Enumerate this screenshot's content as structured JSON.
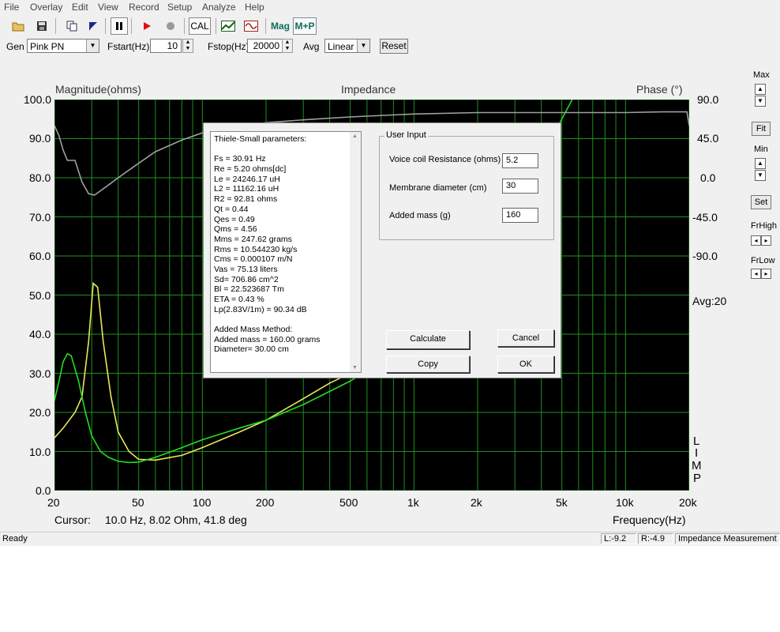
{
  "menu": [
    "File",
    "Overlay",
    "Edit",
    "View",
    "Record",
    "Setup",
    "Analyze",
    "Help"
  ],
  "toolbar": {
    "icons": [
      "open-folder-icon",
      "save-disk-icon",
      "copy-icon",
      "flag-icon",
      "pause-icon",
      "record-icon",
      "stop-icon",
      "cal-button",
      "response-icon",
      "waveform-icon",
      "mag-button",
      "mp-button"
    ],
    "cal_label": "CAL",
    "mag_label": "Mag",
    "mp_label": "M+P"
  },
  "controls": {
    "gen_label": "Gen",
    "gen_value": "Pink PN",
    "fstart_label": "Fstart(Hz)",
    "fstart_value": "10",
    "fstop_label": "Fstop(Hz)",
    "fstop_value": "20000",
    "avg_label": "Avg",
    "avg_value": "Linear",
    "reset_label": "Reset"
  },
  "plot": {
    "left_title": "Magnitude(ohms)",
    "center_title": "Impedance",
    "right_title": "Phase (°)",
    "y_ticks": [
      "100.0",
      "90.0",
      "80.0",
      "70.0",
      "60.0",
      "50.0",
      "40.0",
      "30.0",
      "20.0",
      "10.0",
      "0.0"
    ],
    "phase_ticks": [
      "90.0",
      "45.0",
      "0.0",
      "-45.0",
      "-90.0"
    ],
    "avg_text": "Avg:20",
    "limp_letters": [
      "L",
      "I",
      "M",
      "P"
    ],
    "x_ticks": [
      "20",
      "50",
      "100",
      "200",
      "500",
      "1k",
      "2k",
      "5k",
      "10k",
      "20k"
    ],
    "cursor_label": "Cursor:",
    "cursor_value": "10.0 Hz, 8.02 Ohm, 41.8 deg",
    "x_title": "Frequency(Hz)"
  },
  "chart_data": {
    "type": "line",
    "title": "Impedance",
    "xlabel": "Frequency(Hz)",
    "ylabel": "Magnitude(ohms)",
    "y2label": "Phase (°)",
    "xscale": "log",
    "xlim": [
      20,
      20000
    ],
    "ylim": [
      0,
      100
    ],
    "y2lim": [
      -180,
      90
    ],
    "grid": true,
    "colors": {
      "background": "#000000",
      "grid": "#1f8f1f",
      "yellow": "#e8e85a",
      "green": "#22dd22",
      "phase": "#a0a0a0"
    },
    "series": [
      {
        "color": "yellow",
        "axis": "left",
        "x": [
          20,
          22,
          25,
          27,
          29,
          30.5,
          32,
          34,
          37,
          40,
          45,
          50,
          60,
          80,
          100,
          150,
          200,
          300,
          400,
          500,
          600
        ],
        "y": [
          13.5,
          16,
          20,
          24,
          38,
          53,
          52,
          38,
          24,
          15,
          10,
          8,
          7.8,
          9,
          11,
          15,
          18,
          23.5,
          27.5,
          30,
          32.5
        ]
      },
      {
        "color": "green",
        "axis": "left",
        "x": [
          20,
          21,
          22,
          23,
          24,
          26,
          28,
          30,
          33,
          36,
          40,
          45,
          50,
          60,
          80,
          100,
          150,
          200,
          300,
          500,
          700,
          1000,
          2000,
          3000,
          4000,
          5000,
          5600
        ],
        "y": [
          23,
          28,
          33,
          35,
          34.5,
          28,
          20,
          14,
          10,
          8.5,
          7.5,
          7.2,
          7.3,
          8.5,
          11,
          13,
          16,
          18,
          22,
          28,
          33,
          40,
          58,
          72,
          85,
          95,
          100
        ]
      },
      {
        "color": "phase",
        "axis": "right",
        "x": [
          20,
          21,
          22,
          23,
          25,
          27,
          29,
          30.9,
          33,
          36,
          40,
          50,
          60,
          80,
          100,
          150,
          200,
          300,
          500,
          1000,
          2000,
          5000,
          10000,
          15000,
          19500,
          20000
        ],
        "y": [
          72,
          65,
          55,
          48,
          48,
          33,
          25,
          24,
          27,
          31,
          36,
          46,
          54,
          62,
          67,
          72,
          74,
          76,
          78,
          80,
          81,
          81,
          81,
          81.5,
          81.5,
          72
        ]
      }
    ]
  },
  "right_panel": {
    "max_label": "Max",
    "fit_label": "Fit",
    "min_label": "Min",
    "set_label": "Set",
    "frhigh_label": "FrHigh",
    "frlow_label": "FrLow"
  },
  "status": {
    "ready": "Ready",
    "l_value": "L:-9.2",
    "r_value": "R:-4.9",
    "mode": "Impedance Measurement"
  },
  "dialog": {
    "ts_lines": [
      "Thiele-Small parameters:",
      "",
      "Fs  = 30.91 Hz",
      "Re  = 5.20 ohms[dc]",
      "Le  = 24246.17 uH",
      "L2  = 11162.16 uH",
      "R2  = 92.81 ohms",
      "Qt  = 0.44",
      "Qes = 0.49",
      "Qms = 4.56",
      "Mms = 247.62 grams",
      "Rms = 10.544230 kg/s",
      "Cms = 0.000107 m/N",
      "Vas = 75.13 liters",
      "Sd= 706.86 cm^2",
      "Bl  = 22.523687 Tm",
      "ETA = 0.43 %",
      "Lp(2.83V/1m) = 90.34 dB",
      "",
      "Added Mass Method:",
      "Added mass = 160.00 grams",
      "Diameter= 30.00 cm"
    ],
    "group_title": "User Input",
    "vc_label": "Voice coil Resistance (ohms)",
    "vc_value": "5.2",
    "diam_label": "Membrane diameter (cm)",
    "diam_value": "30",
    "mass_label": "Added mass (g)",
    "mass_value": "160",
    "calculate_label": "Calculate",
    "cancel_label": "Cancel",
    "copy_label": "Copy",
    "ok_label": "OK"
  }
}
